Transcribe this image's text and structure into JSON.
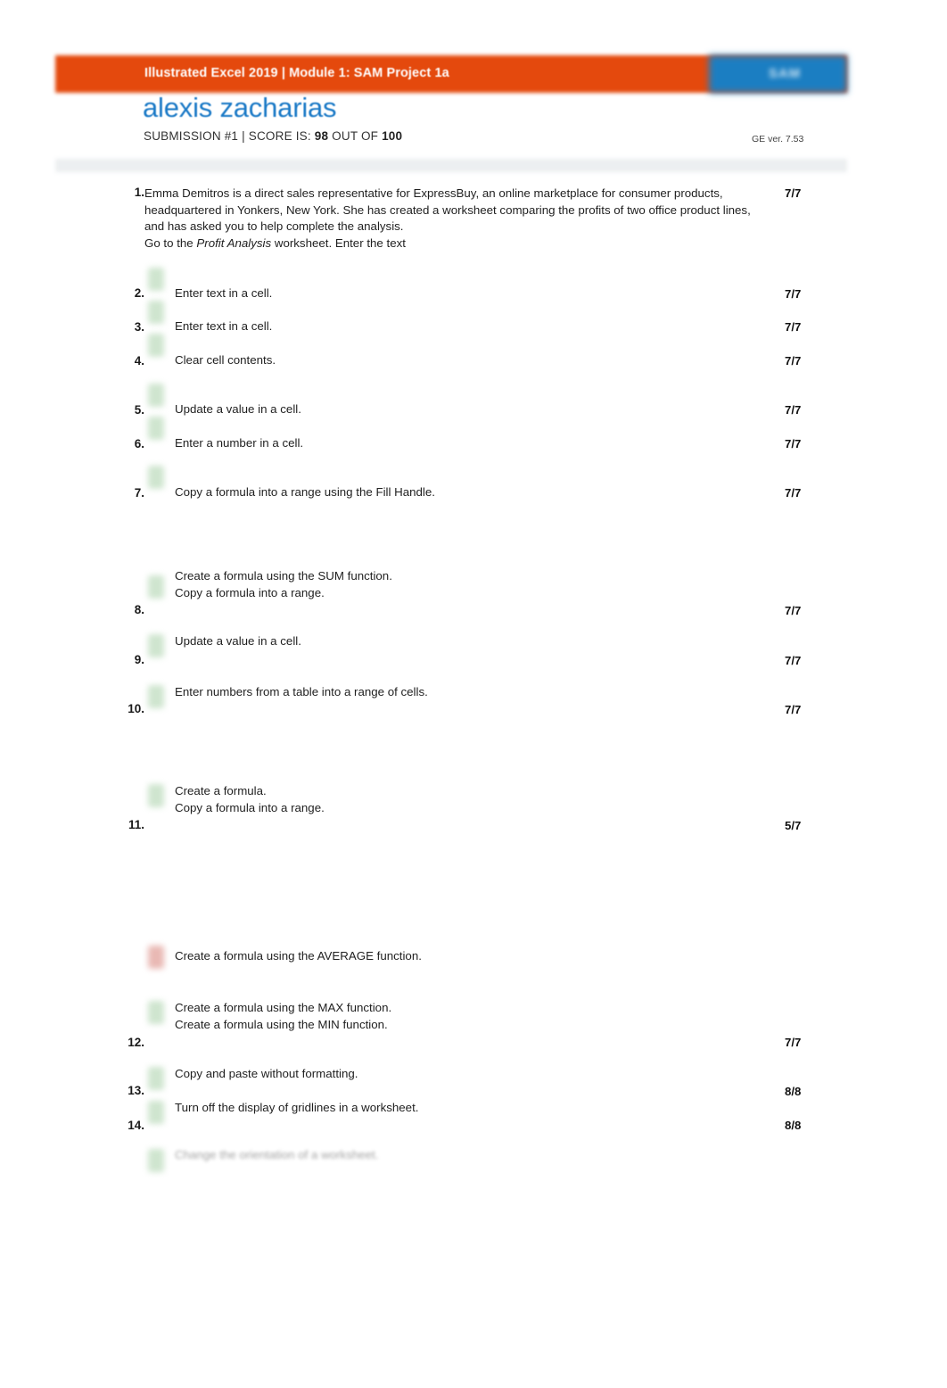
{
  "header": {
    "course_title": "Illustrated Excel 2019 | Module 1: SAM Project 1a",
    "brand_logo_text": "SAM",
    "student_name": "alexis zacharias",
    "submission_label": "SUBMISSION #1",
    "separator": "|",
    "score_prefix": "SCORE IS:",
    "score_value": "98",
    "score_middle": "OUT OF",
    "score_total": "100",
    "score_line_full": "SUBMISSION #1 | SCORE IS: 98 OUT OF 100",
    "ge_version": "GE ver. 7.53"
  },
  "colors": {
    "header_orange": "#e4490d",
    "brand_blue": "#1b7ec2",
    "name_blue": "#1a79c6",
    "separator_band": "#eceff1",
    "status_pass": "#cfe5cf",
    "status_fail": "#e9b9b4"
  },
  "tasks": [
    {
      "number": "1.",
      "status": "none",
      "text_html": "Emma Demitros is a direct sales representative for ExpressBuy, an online marketplace for consumer products, headquartered in Yonkers, New York. She has created a worksheet comparing the profits of two office product lines, and has asked you to help complete the analysis.<br>Go to the <i>Profit Analysis </i> worksheet. Enter the text",
      "score": "7/7"
    },
    {
      "number": "2.",
      "status": "pass",
      "text_html": "Enter text in a cell.",
      "score": "7/7"
    },
    {
      "number": "3.",
      "status": "pass",
      "text_html": "Enter text in a cell.",
      "score": "7/7"
    },
    {
      "number": "4.",
      "status": "pass",
      "text_html": "Clear cell contents.",
      "score": "7/7"
    },
    {
      "number": "5.",
      "status": "pass",
      "text_html": "Update a value in a cell.",
      "score": "7/7"
    },
    {
      "number": "6.",
      "status": "pass",
      "text_html": "Enter a number in a cell.",
      "score": "7/7"
    },
    {
      "number": "7.",
      "status": "pass",
      "text_html": "Copy a formula into a range using the Fill Handle.",
      "score": "7/7"
    },
    {
      "number": "8.",
      "status": "pass",
      "text_html": "Create a formula using the SUM function.<br>Copy a formula into a range.",
      "score": "7/7"
    },
    {
      "number": "9.",
      "status": "pass",
      "text_html": "Update a value in a cell.",
      "score": "7/7"
    },
    {
      "number": "10.",
      "status": "pass",
      "text_html": "Enter numbers from a table into a range of cells.",
      "score": "7/7"
    },
    {
      "number": "11.",
      "status": "pass",
      "text_html": "Create a formula.<br>Copy a formula into a range.",
      "score": "5/7"
    },
    {
      "number": "",
      "status": "fail",
      "text_html": "Create a formula using the AVERAGE function.",
      "score": ""
    },
    {
      "number": "12.",
      "status": "pass",
      "text_html": "Create a formula using the MAX function.<br>Create a formula using the MIN function.",
      "score": "7/7"
    },
    {
      "number": "13.",
      "status": "pass",
      "text_html": "Copy and paste without formatting.",
      "score": "8/8"
    },
    {
      "number": "14.",
      "status": "pass",
      "text_html": "Turn off the display of gridlines in a worksheet.",
      "score": "8/8"
    },
    {
      "number": "",
      "status": "pass",
      "text_html": "Change the orientation of a worksheet.",
      "score": "",
      "faded": true
    }
  ],
  "layout": {
    "task_tops": [
      208,
      320,
      357,
      395,
      450,
      488,
      543,
      637,
      710,
      767,
      878,
      1063,
      1121,
      1195,
      1233,
      1286
    ],
    "num_tops": [
      208,
      321,
      359,
      397,
      452,
      490,
      545,
      676,
      732,
      787,
      917,
      0,
      1161,
      1215,
      1254,
      0
    ],
    "icon_tops": [
      0,
      300,
      337,
      374,
      430,
      467,
      522,
      645,
      711,
      768,
      879,
      1060,
      1122,
      1196,
      1234,
      1288
    ],
    "score_tops": [
      209,
      322,
      359,
      397,
      452,
      490,
      545,
      677,
      733,
      788,
      918,
      0,
      1161,
      1216,
      1254,
      0
    ]
  }
}
